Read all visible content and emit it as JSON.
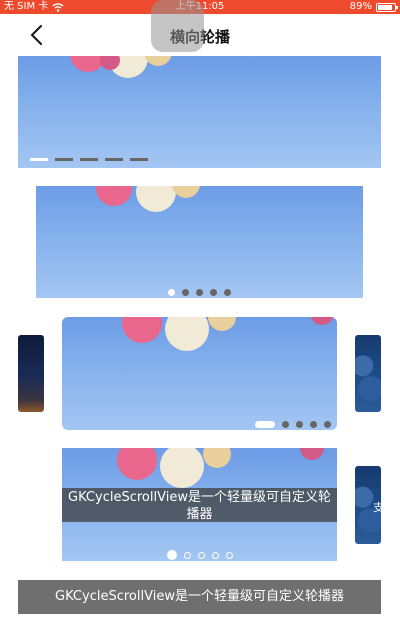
{
  "status_bar": {
    "carrier": "无 SIM 卡",
    "time": "上午11:05",
    "battery": "89%",
    "battery_level": 0.89
  },
  "nav": {
    "title": "横向轮播"
  },
  "banners": {
    "caption": "GKCycleScrollView是一个轻量级可自定义轮播器",
    "side_caption_fragment": "支",
    "bottom_caption": "GKCycleScrollView是一个轻量级可自定义轮播器"
  },
  "colors": {
    "status_bar": "#ee4a2e",
    "sky": "#85b1ec",
    "indicator_active": "#ffffff",
    "indicator_inactive": "#666666"
  }
}
